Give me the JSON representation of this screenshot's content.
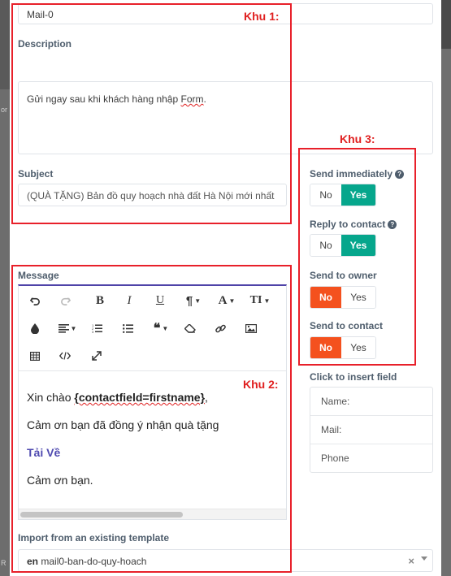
{
  "name_field": {
    "value": "Mail-0"
  },
  "description": {
    "label": "Description",
    "value": "Gửi ngay sau khi khách hàng nhập ",
    "value_underlined": "Form",
    "value_end": "."
  },
  "subject": {
    "label": "Subject",
    "value": "(QUÀ TẶNG) Bản đồ quy hoạch nhà đất Hà Nội mới nhất"
  },
  "message": {
    "label": "Message",
    "toolbar": [
      "undo-icon",
      "redo-icon",
      "bold-icon",
      "italic-icon",
      "underline-icon",
      "paragraph-icon",
      "font-color-icon",
      "font-size-icon",
      "ink-drop-icon",
      "align-icon",
      "ordered-list-icon",
      "unordered-list-icon",
      "quote-icon",
      "eraser-icon",
      "link-icon",
      "image-icon",
      "table-icon",
      "code-view-icon",
      "fullscreen-icon"
    ],
    "toolbar_glyphs": {
      "bold": "B",
      "italic": "I",
      "underline": "U",
      "paragraph": "¶",
      "font_color": "A",
      "font_size": "TI"
    },
    "body": {
      "greeting_prefix": "Xin chào ",
      "greeting_token": "{contactfield=firstname}",
      "greeting_suffix": ",",
      "line2": "Cảm ơn bạn đã đồng ý nhận quà tặng",
      "link": "Tải Về",
      "line4": "Cảm ơn bạn."
    }
  },
  "template": {
    "label": "Import from an existing template",
    "lang": "en",
    "value": "mail0-ban-do-quy-hoach",
    "clear_glyph": "×"
  },
  "options": [
    {
      "label": "Send immediately",
      "help": "?",
      "no": "No",
      "yes": "Yes",
      "selected": "Yes"
    },
    {
      "label": "Reply to contact",
      "help": "?",
      "no": "No",
      "yes": "Yes",
      "selected": "Yes"
    },
    {
      "label": "Send to owner",
      "no": "No",
      "yes": "Yes",
      "selected": "No"
    },
    {
      "label": "Send to contact",
      "no": "No",
      "yes": "Yes",
      "selected": "No"
    }
  ],
  "insert_field": {
    "label": "Click to insert field",
    "items": [
      "Name:",
      "Mail:",
      "Phone"
    ]
  },
  "annotations": {
    "zone1": "Khu 1:",
    "zone2": "Khu 2:",
    "zone3": "Khu 3:"
  },
  "background": {
    "left_text_1": "or",
    "left_text_2": "R"
  },
  "colors": {
    "yes_active": "#06a68c",
    "no_active": "#f4511e",
    "annotation_red": "#e8202a",
    "editor_accent": "#4f43a8",
    "link": "#4f4ab0"
  }
}
